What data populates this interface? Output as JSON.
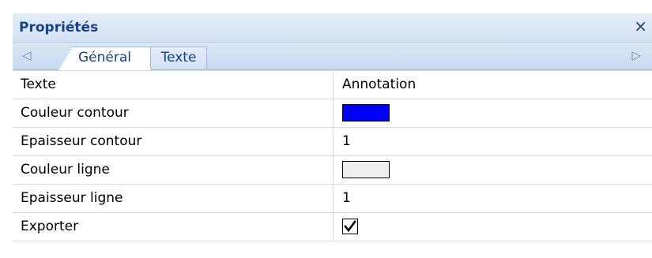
{
  "panel": {
    "title": "Propriétés",
    "close_glyph": "×"
  },
  "tabs": {
    "left_arrow": "◁",
    "right_arrow": "▷",
    "items": [
      {
        "label": "Général",
        "active": true
      },
      {
        "label": "Texte",
        "active": false
      }
    ]
  },
  "properties": [
    {
      "name": "Texte",
      "value": "Annotation",
      "kind": "text"
    },
    {
      "name": "Couleur contour",
      "value": "",
      "kind": "color",
      "color": "#0000ff"
    },
    {
      "name": "Epaisseur contour",
      "value": "1",
      "kind": "text"
    },
    {
      "name": "Couleur ligne",
      "value": "",
      "kind": "color",
      "color": "#eeeeee"
    },
    {
      "name": "Epaisseur ligne",
      "value": "1",
      "kind": "text"
    },
    {
      "name": "Exporter",
      "value": "",
      "kind": "checkbox",
      "checked": true
    }
  ]
}
